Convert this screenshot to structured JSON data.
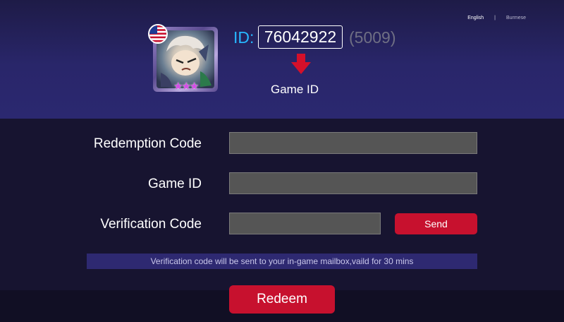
{
  "languages": [
    {
      "label": "English",
      "selected": true
    },
    {
      "label": "Burmese",
      "selected": false
    }
  ],
  "language_separator": "|",
  "player": {
    "id_label": "ID:",
    "id_value": "76042922",
    "server": "(5009)",
    "caption": "Game ID",
    "avatar_icon": "hero-avatar",
    "flag_icon": "us-flag-icon",
    "stars": "★★★"
  },
  "form": {
    "redemption_label": "Redemption Code",
    "redemption_value": "",
    "game_id_label": "Game ID",
    "game_id_value": "",
    "verification_label": "Verification Code",
    "verification_value": "",
    "send_label": "Send",
    "notice": "Verification code will be sent to your in-game mailbox,vaild for 30 mins",
    "redeem_label": "Redeem"
  },
  "colors": {
    "accent_red": "#c7112e",
    "id_blue": "#27b7ff",
    "notice_bg": "#2e2971"
  }
}
